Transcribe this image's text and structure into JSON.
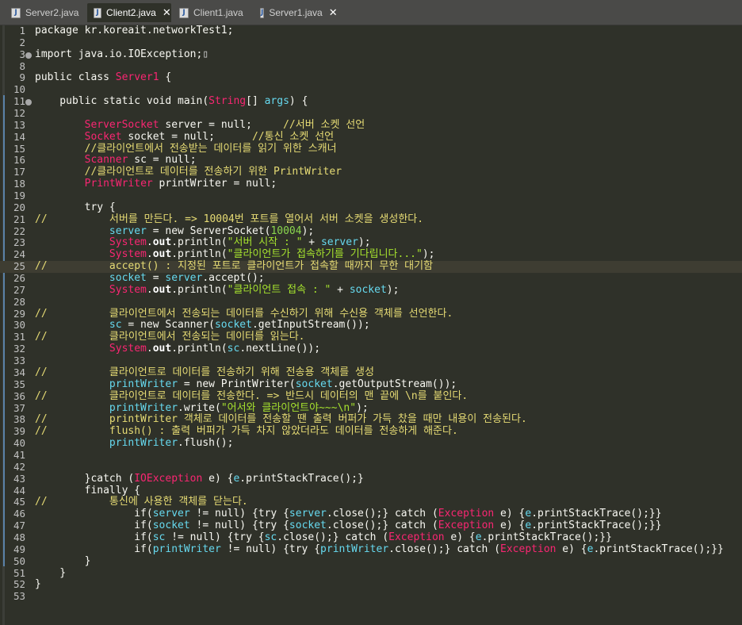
{
  "tabs": [
    {
      "name": "Server2.java",
      "active": false,
      "closable": false
    },
    {
      "name": "Client2.java",
      "active": true,
      "closable": true
    },
    {
      "name": "Client1.java",
      "active": false,
      "closable": false
    },
    {
      "name": "Server1.java",
      "active": false,
      "closable": true
    }
  ],
  "colors": {
    "background": "#2f3129",
    "plain": "#f8f8f2",
    "class_type": "#f92672",
    "comment": "#e6db74",
    "parameter": "#66d9ef",
    "string": "#a6e22e",
    "number": "#8ad64e",
    "field": "#ffffff",
    "gutter_bar": "#5a82a8"
  },
  "editor": {
    "current_line": 25,
    "lines": [
      {
        "n": "1",
        "t": [
          [
            "n",
            "package kr.koreait.networkTest1;"
          ]
        ]
      },
      {
        "n": "2",
        "t": []
      },
      {
        "n": "3",
        "fold": true,
        "t": [
          [
            "n",
            "import java.io.IOException;"
          ],
          [
            "x",
            "▯"
          ]
        ]
      },
      {
        "n": "8",
        "t": []
      },
      {
        "n": "9",
        "t": [
          [
            "n",
            "public class "
          ],
          [
            "o",
            "Server1"
          ],
          [
            "n",
            " {"
          ]
        ]
      },
      {
        "n": "10",
        "t": []
      },
      {
        "n": "11",
        "fold": true,
        "t": [
          [
            "n",
            "    public static void main("
          ],
          [
            "o",
            "String"
          ],
          [
            "n",
            "[] "
          ],
          [
            "p",
            "args"
          ],
          [
            "n",
            ") {"
          ]
        ]
      },
      {
        "n": "12",
        "t": []
      },
      {
        "n": "13",
        "t": [
          [
            "n",
            "        "
          ],
          [
            "o",
            "ServerSocket"
          ],
          [
            "n",
            " server = null;     "
          ],
          [
            "c",
            "//서버 소켓 선언"
          ]
        ]
      },
      {
        "n": "14",
        "t": [
          [
            "n",
            "        "
          ],
          [
            "o",
            "Socket"
          ],
          [
            "n",
            " socket = null;      "
          ],
          [
            "c",
            "//통신 소켓 선언"
          ]
        ]
      },
      {
        "n": "15",
        "t": [
          [
            "n",
            "        "
          ],
          [
            "c",
            "//클라이언트에서 전송받는 데이터를 읽기 위한 스캐너"
          ]
        ]
      },
      {
        "n": "16",
        "t": [
          [
            "n",
            "        "
          ],
          [
            "o",
            "Scanner"
          ],
          [
            "n",
            " sc = null;"
          ]
        ]
      },
      {
        "n": "17",
        "t": [
          [
            "n",
            "        "
          ],
          [
            "c",
            "//클라이언트로 데이터를 전송하기 위한 PrintWriter"
          ]
        ]
      },
      {
        "n": "18",
        "t": [
          [
            "n",
            "        "
          ],
          [
            "o",
            "PrintWriter"
          ],
          [
            "n",
            " printWriter = null;"
          ]
        ]
      },
      {
        "n": "19",
        "t": []
      },
      {
        "n": "20",
        "t": [
          [
            "n",
            "        try {"
          ]
        ]
      },
      {
        "n": "21",
        "t": [
          [
            "c",
            "//          서버를 만든다. => 10004번 포트를 열어서 서버 소켓을 생성한다."
          ]
        ]
      },
      {
        "n": "22",
        "t": [
          [
            "n",
            "            "
          ],
          [
            "p",
            "server"
          ],
          [
            "n",
            " = new ServerSocket("
          ],
          [
            "g",
            "10004"
          ],
          [
            "n",
            ");"
          ]
        ]
      },
      {
        "n": "23",
        "t": [
          [
            "n",
            "            "
          ],
          [
            "o",
            "System"
          ],
          [
            "n",
            "."
          ],
          [
            "f",
            "out"
          ],
          [
            "n",
            ".println("
          ],
          [
            "s",
            "\"서버 시작 : \""
          ],
          [
            "n",
            " + "
          ],
          [
            "p",
            "server"
          ],
          [
            "n",
            ");"
          ]
        ]
      },
      {
        "n": "24",
        "t": [
          [
            "n",
            "            "
          ],
          [
            "o",
            "System"
          ],
          [
            "n",
            "."
          ],
          [
            "f",
            "out"
          ],
          [
            "n",
            ".println("
          ],
          [
            "s",
            "\"클라이언트가 접속하기를 기다립니다...\""
          ],
          [
            "n",
            ");"
          ]
        ]
      },
      {
        "n": "25",
        "t": [
          [
            "c",
            "//          accept() : 지정된 포트로 클라이언트가 접속할 때까지 무한 대기함"
          ]
        ]
      },
      {
        "n": "26",
        "t": [
          [
            "n",
            "            "
          ],
          [
            "p",
            "socket"
          ],
          [
            "n",
            " = "
          ],
          [
            "p",
            "server"
          ],
          [
            "n",
            ".accept();"
          ]
        ]
      },
      {
        "n": "27",
        "t": [
          [
            "n",
            "            "
          ],
          [
            "o",
            "System"
          ],
          [
            "n",
            "."
          ],
          [
            "f",
            "out"
          ],
          [
            "n",
            ".println("
          ],
          [
            "s",
            "\"클라이언트 접속 : \""
          ],
          [
            "n",
            " + "
          ],
          [
            "p",
            "socket"
          ],
          [
            "n",
            ");"
          ]
        ]
      },
      {
        "n": "28",
        "t": []
      },
      {
        "n": "29",
        "t": [
          [
            "c",
            "//          클라이언트에서 전송되는 데이터를 수신하기 위해 수신용 객체를 선언한다."
          ]
        ]
      },
      {
        "n": "30",
        "t": [
          [
            "n",
            "            "
          ],
          [
            "p",
            "sc"
          ],
          [
            "n",
            " = new Scanner("
          ],
          [
            "p",
            "socket"
          ],
          [
            "n",
            ".getInputStream());"
          ]
        ]
      },
      {
        "n": "31",
        "t": [
          [
            "c",
            "//          클라이언트에서 전송되는 데이터를 읽는다."
          ]
        ]
      },
      {
        "n": "32",
        "t": [
          [
            "n",
            "            "
          ],
          [
            "o",
            "System"
          ],
          [
            "n",
            "."
          ],
          [
            "f",
            "out"
          ],
          [
            "n",
            ".println("
          ],
          [
            "p",
            "sc"
          ],
          [
            "n",
            ".nextLine());"
          ]
        ]
      },
      {
        "n": "33",
        "t": []
      },
      {
        "n": "34",
        "t": [
          [
            "c",
            "//          클라이언트로 데이터를 전송하기 위해 전송용 객체를 생성"
          ]
        ]
      },
      {
        "n": "35",
        "t": [
          [
            "n",
            "            "
          ],
          [
            "p",
            "printWriter"
          ],
          [
            "n",
            " = new PrintWriter("
          ],
          [
            "p",
            "socket"
          ],
          [
            "n",
            ".getOutputStream());"
          ]
        ]
      },
      {
        "n": "36",
        "t": [
          [
            "c",
            "//          클라이언트로 데이터를 전송한다. => 반드시 데이터의 맨 끝에 \\n를 붙인다."
          ]
        ]
      },
      {
        "n": "37",
        "t": [
          [
            "n",
            "            "
          ],
          [
            "p",
            "printWriter"
          ],
          [
            "n",
            ".write("
          ],
          [
            "s",
            "\"어서와 클라이언트야~~~\\n\""
          ],
          [
            "n",
            ");"
          ]
        ]
      },
      {
        "n": "38",
        "t": [
          [
            "c",
            "//          printWriter 객체로 데이터를 전송할 땐 출력 버퍼가 가득 찼을 때만 내용이 전송된다."
          ]
        ]
      },
      {
        "n": "39",
        "t": [
          [
            "c",
            "//          flush() : 출력 버퍼가 가득 차지 않았더라도 데이터를 전송하게 해준다."
          ]
        ]
      },
      {
        "n": "40",
        "t": [
          [
            "n",
            "            "
          ],
          [
            "p",
            "printWriter"
          ],
          [
            "n",
            ".flush();"
          ]
        ]
      },
      {
        "n": "41",
        "t": []
      },
      {
        "n": "42",
        "t": []
      },
      {
        "n": "43",
        "t": [
          [
            "n",
            "        }catch ("
          ],
          [
            "o",
            "IOException"
          ],
          [
            "n",
            " e) {"
          ],
          [
            "p",
            "e"
          ],
          [
            "n",
            ".printStackTrace();}"
          ]
        ]
      },
      {
        "n": "44",
        "t": [
          [
            "n",
            "        finally {"
          ]
        ]
      },
      {
        "n": "45",
        "t": [
          [
            "c",
            "//          통신에 사용한 객체를 닫는다."
          ]
        ]
      },
      {
        "n": "46",
        "t": [
          [
            "n",
            "                if("
          ],
          [
            "p",
            "server"
          ],
          [
            "n",
            " != null) {try {"
          ],
          [
            "p",
            "server"
          ],
          [
            "n",
            ".close();} catch ("
          ],
          [
            "o",
            "Exception"
          ],
          [
            "n",
            " e) {"
          ],
          [
            "p",
            "e"
          ],
          [
            "n",
            ".printStackTrace();}}"
          ]
        ]
      },
      {
        "n": "47",
        "t": [
          [
            "n",
            "                if("
          ],
          [
            "p",
            "socket"
          ],
          [
            "n",
            " != null) {try {"
          ],
          [
            "p",
            "socket"
          ],
          [
            "n",
            ".close();} catch ("
          ],
          [
            "o",
            "Exception"
          ],
          [
            "n",
            " e) {"
          ],
          [
            "p",
            "e"
          ],
          [
            "n",
            ".printStackTrace();}}"
          ]
        ]
      },
      {
        "n": "48",
        "t": [
          [
            "n",
            "                if("
          ],
          [
            "p",
            "sc"
          ],
          [
            "n",
            " != null) {try {"
          ],
          [
            "p",
            "sc"
          ],
          [
            "n",
            ".close();} catch ("
          ],
          [
            "o",
            "Exception"
          ],
          [
            "n",
            " e) {"
          ],
          [
            "p",
            "e"
          ],
          [
            "n",
            ".printStackTrace();}}"
          ]
        ]
      },
      {
        "n": "49",
        "t": [
          [
            "n",
            "                if("
          ],
          [
            "p",
            "printWriter"
          ],
          [
            "n",
            " != null) {try {"
          ],
          [
            "p",
            "printWriter"
          ],
          [
            "n",
            ".close();} catch ("
          ],
          [
            "o",
            "Exception"
          ],
          [
            "n",
            " e) {"
          ],
          [
            "p",
            "e"
          ],
          [
            "n",
            ".printStackTrace();}}"
          ]
        ]
      },
      {
        "n": "50",
        "t": [
          [
            "n",
            "        }"
          ]
        ]
      },
      {
        "n": "51",
        "t": [
          [
            "n",
            "    }"
          ]
        ]
      },
      {
        "n": "52",
        "t": [
          [
            "n",
            "}"
          ]
        ]
      },
      {
        "n": "53",
        "t": []
      }
    ]
  }
}
